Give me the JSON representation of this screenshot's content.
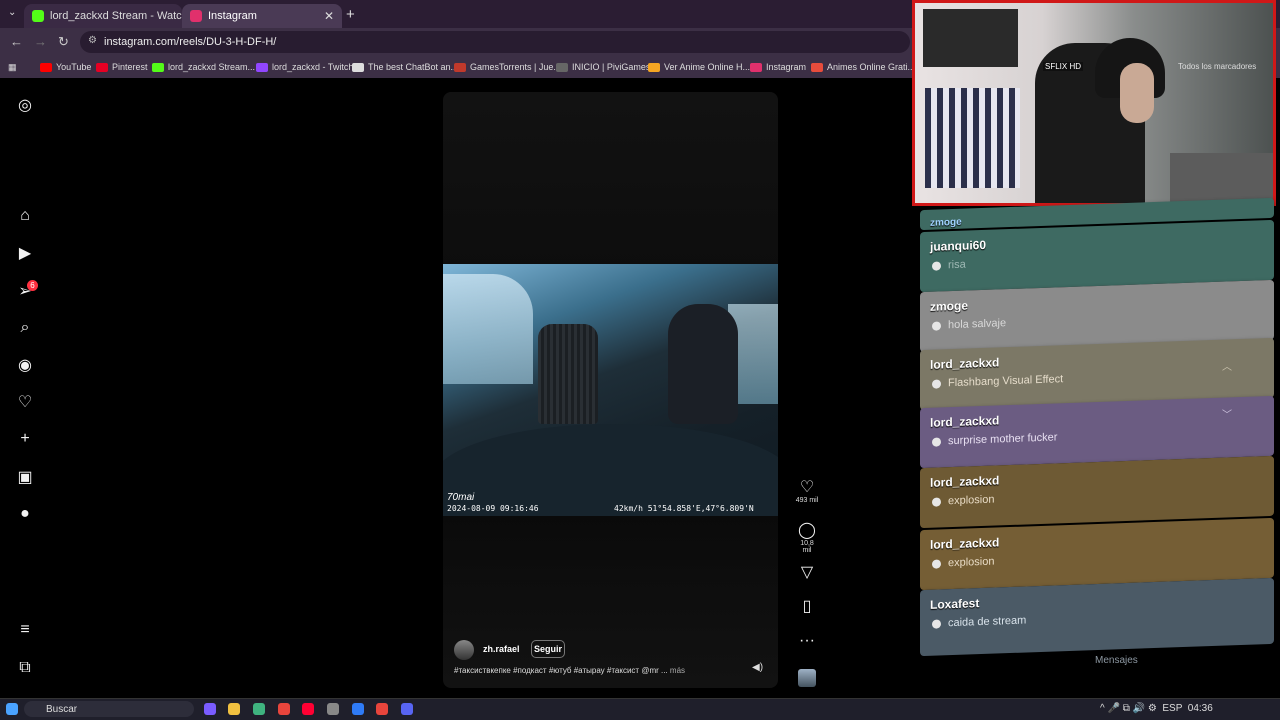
{
  "browser": {
    "tabs": [
      {
        "label": "lord_zackxd Stream - Watch Liv",
        "close": "✕",
        "favicon_color": "#53fc18"
      },
      {
        "label": "Instagram",
        "close": "✕",
        "favicon_color": "#e1306c"
      }
    ],
    "new_tab": "+",
    "url": "instagram.com/reels/DU-3-H-DF-H/",
    "bookmarks": [
      {
        "label": "YouTube",
        "color": "#ff0000"
      },
      {
        "label": "Pinterest",
        "color": "#e60023"
      },
      {
        "label": "lord_zackxd Stream...",
        "color": "#53fc18"
      },
      {
        "label": "lord_zackxd - Twitch",
        "color": "#9146ff"
      },
      {
        "label": "The best ChatBot an...",
        "color": "#dddddd"
      },
      {
        "label": "GamesTorrents | Jue...",
        "color": "#c0392b"
      },
      {
        "label": "INICIO | PiviGames",
        "color": "#444444"
      },
      {
        "label": "Ver Anime Online H...",
        "color": "#f5a623"
      },
      {
        "label": "Instagram",
        "color": "#e1306c"
      },
      {
        "label": "Animes Online Grati...",
        "color": "#e74c3c"
      }
    ],
    "bookmarks_folder": "Todos los marcadores",
    "partial_bookmark": "SFLIX HD"
  },
  "instagram": {
    "notification_count": "6",
    "reel": {
      "camera_brand": "70mai",
      "camera_timestamp": "2024-08-09 09:16:46",
      "camera_gps": "42km/h  51°54.858'E,47°6.809'N",
      "author": "zh.rafael",
      "follow_label": "Seguir",
      "caption": "#таксиствкепке #подкаст #ютуб #атырау #таксист @mr ...",
      "more_label": "más",
      "likes": "493 mil",
      "comments": "10,8 mil"
    }
  },
  "chat": {
    "partial_user": "zmoge",
    "messages": [
      {
        "user": "juanqui60",
        "text": "risa"
      },
      {
        "user": "zmoge",
        "text": "hola salvaje"
      },
      {
        "user": "lord_zackxd",
        "text": "Flashbang Visual Effect"
      },
      {
        "user": "lord_zackxd",
        "text": "surprise mother fucker"
      },
      {
        "user": "lord_zackxd",
        "text": "explosion"
      },
      {
        "user": "lord_zackxd",
        "text": "explosion"
      },
      {
        "user": "Loxafest",
        "text": "caida de stream"
      }
    ],
    "footer_label": "Mensajes"
  },
  "taskbar": {
    "search_placeholder": "Buscar",
    "tray_lang": "ESP",
    "tray_time": "04:36"
  }
}
